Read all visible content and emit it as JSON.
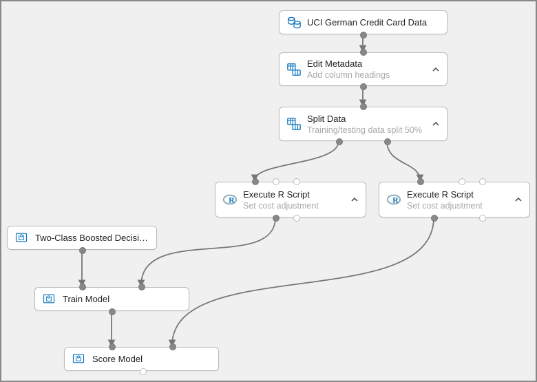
{
  "nodes": {
    "dataset": {
      "title": "UCI German Credit Card Data"
    },
    "edit_meta": {
      "title": "Edit Metadata",
      "subtitle": "Add column headings"
    },
    "split_data": {
      "title": "Split Data",
      "subtitle": "Training/testing data split 50%"
    },
    "r_left": {
      "title": "Execute R Script",
      "subtitle": "Set cost adjustment"
    },
    "r_right": {
      "title": "Execute R Script",
      "subtitle": "Set cost adjustment"
    },
    "two_class": {
      "title": "Two-Class Boosted Decision..."
    },
    "train_model": {
      "title": "Train Model"
    },
    "score_model": {
      "title": "Score Model"
    }
  }
}
